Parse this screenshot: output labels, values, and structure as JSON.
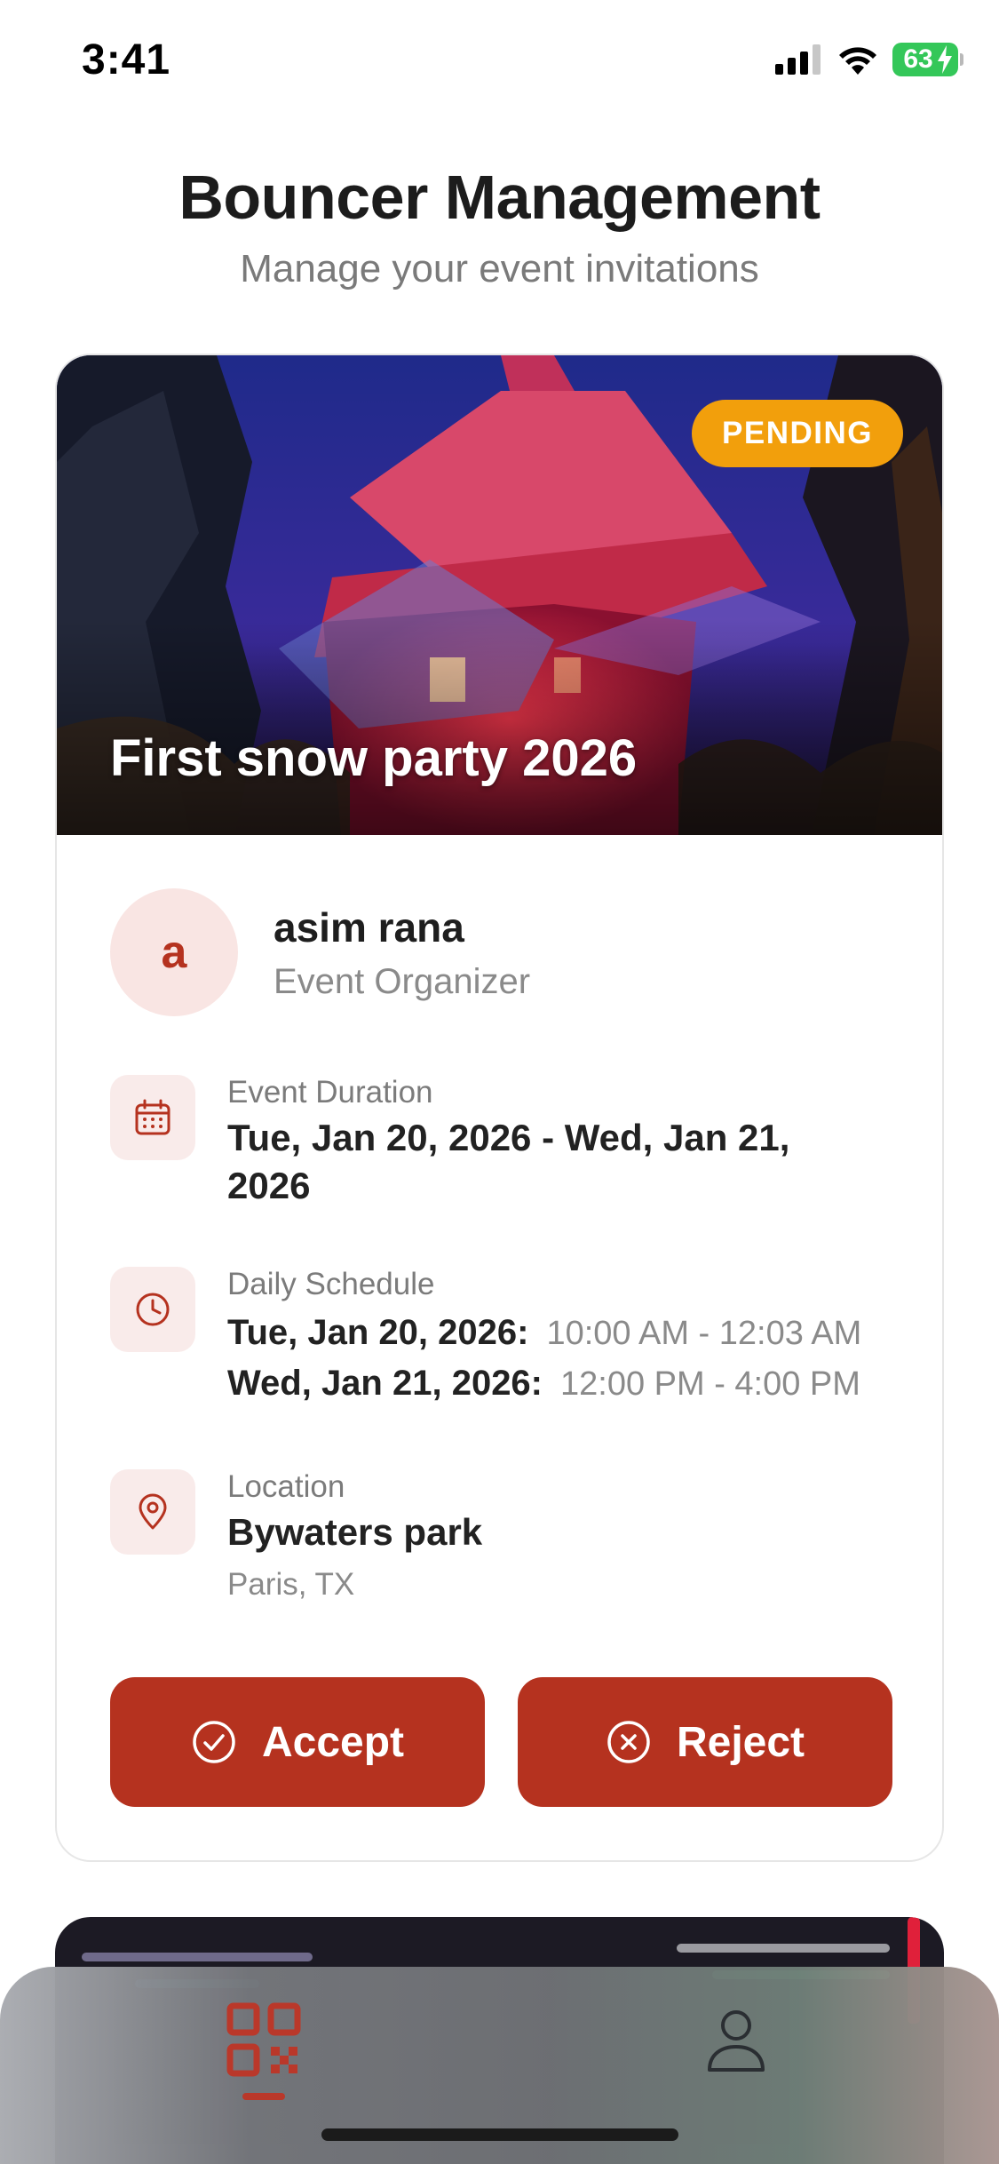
{
  "status_bar": {
    "time": "3:41",
    "battery_level": "63",
    "icons": [
      "cellular-signal-icon",
      "wifi-icon",
      "battery-charging-icon"
    ]
  },
  "header": {
    "title": "Bouncer Management",
    "subtitle": "Manage your event invitations"
  },
  "invitation": {
    "event_title": "First snow party 2026",
    "status": "PENDING",
    "status_color": "#f29f0c",
    "organizer": {
      "initial": "a",
      "name": "asim rana",
      "role": "Event Organizer"
    },
    "duration": {
      "label": "Event Duration",
      "value": "Tue, Jan 20, 2026 - Wed, Jan 21, 2026",
      "icon": "calendar-icon"
    },
    "schedule": {
      "label": "Daily Schedule",
      "icon": "clock-icon",
      "entries": [
        {
          "date": "Tue, Jan 20, 2026:",
          "time": "10:00 AM - 12:03 AM"
        },
        {
          "date": "Wed, Jan 21, 2026:",
          "time": "12:00 PM - 4:00 PM"
        }
      ]
    },
    "location": {
      "label": "Location",
      "name": "Bywaters park",
      "city": "Paris, TX",
      "icon": "map-pin-icon"
    },
    "actions": {
      "accept_label": "Accept",
      "reject_label": "Reject"
    }
  },
  "tab_bar": {
    "tabs": [
      {
        "icon": "qr-code-icon",
        "active": true
      },
      {
        "icon": "user-icon",
        "active": false
      }
    ],
    "accent_color": "#c0392b"
  },
  "colors": {
    "primary": "#b5321f",
    "badge": "#f29f0c",
    "icon_bg": "#f9ebea"
  }
}
